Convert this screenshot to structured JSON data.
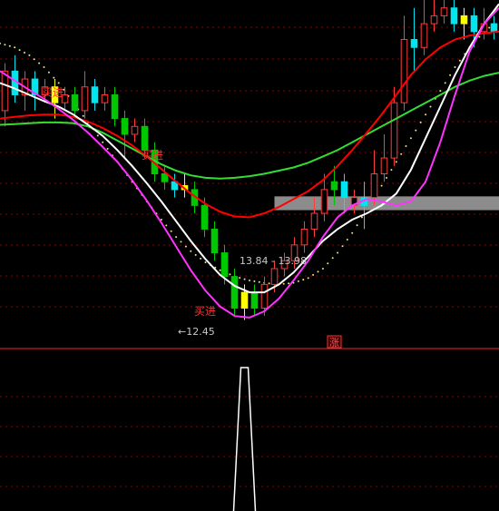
{
  "chart_data": {
    "type": "candlestick",
    "colors": {
      "background": "#000000",
      "grid": "#8b0000",
      "up": "#ff3b3b",
      "down_green": "#00c800",
      "down_cyan": "#00e5ee",
      "doji_yellow": "#ffff00",
      "ma_white": "#ffffff",
      "ma_magenta": "#ff33ff",
      "ma_red": "#ff0000",
      "ma_green": "#33dd33",
      "dotted": "#e6e68c",
      "band": "#8c8c8c",
      "spike": "#ffffff"
    },
    "price_axis": {
      "ylim": [
        12.1,
        16.5
      ]
    },
    "candles": [
      [
        15.1,
        15.6,
        15.7,
        14.9,
        "up"
      ],
      [
        15.6,
        15.3,
        15.8,
        15.2,
        "down_cyan"
      ],
      [
        15.3,
        15.5,
        15.6,
        15.1,
        "up"
      ],
      [
        15.5,
        15.3,
        15.6,
        15.1,
        "down_cyan"
      ],
      [
        15.3,
        15.4,
        15.5,
        15.2,
        "up"
      ],
      [
        15.4,
        15.2,
        15.5,
        15.0,
        "doji_yellow"
      ],
      [
        15.2,
        15.3,
        15.4,
        15.1,
        "up"
      ],
      [
        15.3,
        15.1,
        15.4,
        15.0,
        "down_green"
      ],
      [
        15.1,
        15.4,
        15.6,
        15.0,
        "up"
      ],
      [
        15.4,
        15.2,
        15.5,
        15.1,
        "down_cyan"
      ],
      [
        15.2,
        15.3,
        15.4,
        15.1,
        "up"
      ],
      [
        15.3,
        15.0,
        15.4,
        14.9,
        "down_green"
      ],
      [
        15.0,
        14.8,
        15.1,
        14.5,
        "down_green"
      ],
      [
        14.8,
        14.9,
        15.0,
        14.7,
        "up"
      ],
      [
        14.9,
        14.6,
        15.0,
        14.5,
        "down_green"
      ],
      [
        14.6,
        14.3,
        14.7,
        14.2,
        "down_green"
      ],
      [
        14.3,
        14.2,
        14.4,
        14.1,
        "down_green"
      ],
      [
        14.2,
        14.1,
        14.3,
        14.0,
        "down_cyan"
      ],
      [
        14.1,
        14.15,
        14.3,
        14.0,
        "doji_yellow"
      ],
      [
        14.1,
        13.9,
        14.2,
        13.8,
        "down_green"
      ],
      [
        13.9,
        13.6,
        14.0,
        13.5,
        "down_green"
      ],
      [
        13.6,
        13.3,
        13.7,
        13.2,
        "down_green"
      ],
      [
        13.3,
        13.0,
        13.4,
        12.9,
        "down_green"
      ],
      [
        13.0,
        12.6,
        13.1,
        12.5,
        "down_green"
      ],
      [
        12.6,
        12.8,
        12.9,
        12.45,
        "doji_yellow"
      ],
      [
        12.8,
        12.6,
        12.9,
        12.5,
        "down_green"
      ],
      [
        12.6,
        12.9,
        13.0,
        12.5,
        "up"
      ],
      [
        12.9,
        13.1,
        13.2,
        12.8,
        "up"
      ],
      [
        13.1,
        13.2,
        13.3,
        13.0,
        "up"
      ],
      [
        13.2,
        13.4,
        13.5,
        13.1,
        "up"
      ],
      [
        13.4,
        13.6,
        13.7,
        13.3,
        "up"
      ],
      [
        13.6,
        13.8,
        14.0,
        13.5,
        "up"
      ],
      [
        13.8,
        14.1,
        14.3,
        13.7,
        "up"
      ],
      [
        14.1,
        14.2,
        14.4,
        13.9,
        "down_green"
      ],
      [
        14.2,
        14.0,
        14.3,
        13.8,
        "down_cyan"
      ],
      [
        14.0,
        13.9,
        14.1,
        13.8,
        "up"
      ],
      [
        13.9,
        14.0,
        14.2,
        13.6,
        "down_cyan"
      ],
      [
        14.0,
        14.3,
        14.6,
        13.9,
        "up"
      ],
      [
        14.3,
        14.5,
        14.8,
        14.2,
        "up"
      ],
      [
        14.5,
        15.2,
        15.4,
        14.4,
        "up"
      ],
      [
        15.2,
        16.0,
        16.3,
        15.1,
        "up"
      ],
      [
        16.0,
        15.9,
        16.4,
        15.6,
        "down_cyan"
      ],
      [
        15.9,
        16.2,
        16.5,
        15.8,
        "up"
      ],
      [
        16.2,
        16.3,
        16.5,
        16.1,
        "up"
      ],
      [
        16.3,
        16.4,
        16.5,
        16.2,
        "up"
      ],
      [
        16.4,
        16.2,
        16.5,
        16.1,
        "down_cyan"
      ],
      [
        16.2,
        16.3,
        16.4,
        16.0,
        "doji_yellow"
      ],
      [
        16.3,
        16.1,
        16.4,
        15.9,
        "down_cyan"
      ],
      [
        16.1,
        16.2,
        16.4,
        16.0,
        "up"
      ],
      [
        16.2,
        16.1,
        16.3,
        16.0,
        "down_cyan"
      ]
    ],
    "ma_white": [
      15.45,
      15.38,
      15.3,
      15.22,
      15.15,
      15.05,
      14.92,
      14.78,
      14.6,
      14.4,
      14.18,
      13.95,
      13.7,
      13.45,
      13.22,
      13.02,
      12.88,
      12.8,
      12.8,
      12.9,
      13.05,
      13.25,
      13.45,
      13.6,
      13.72,
      13.8,
      13.9,
      14.05,
      14.35,
      14.75,
      15.15,
      15.55,
      15.9,
      16.2,
      16.45
    ],
    "ma_magenta": [
      15.6,
      15.48,
      15.36,
      15.25,
      15.12,
      14.98,
      14.82,
      14.64,
      14.45,
      14.22,
      13.96,
      13.68,
      13.38,
      13.08,
      12.82,
      12.62,
      12.5,
      12.48,
      12.56,
      12.72,
      12.95,
      13.2,
      13.5,
      13.75,
      13.9,
      13.98,
      13.95,
      13.9,
      13.95,
      14.2,
      14.7,
      15.3,
      15.85,
      16.2,
      16.4
    ],
    "ma_red": [
      15.0,
      15.02,
      15.04,
      15.05,
      15.05,
      15.02,
      14.96,
      14.88,
      14.78,
      14.66,
      14.52,
      14.36,
      14.2,
      14.05,
      13.92,
      13.82,
      13.76,
      13.75,
      13.8,
      13.88,
      13.98,
      14.08,
      14.22,
      14.4,
      14.6,
      14.82,
      15.05,
      15.3,
      15.55,
      15.75,
      15.9,
      16.0,
      16.05,
      16.08,
      16.1
    ],
    "ma_green": [
      14.92,
      14.93,
      14.94,
      14.95,
      14.95,
      14.94,
      14.9,
      14.82,
      14.72,
      14.62,
      14.52,
      14.42,
      14.34,
      14.28,
      14.25,
      14.24,
      14.25,
      14.27,
      14.3,
      14.34,
      14.38,
      14.44,
      14.52,
      14.6,
      14.7,
      14.8,
      14.9,
      15.0,
      15.1,
      15.2,
      15.3,
      15.4,
      15.48,
      15.54,
      15.58
    ],
    "dotted": [
      15.95,
      15.9,
      15.8,
      15.65,
      15.45,
      15.2,
      14.95,
      14.7,
      14.45,
      14.2,
      13.95,
      13.72,
      13.5,
      13.32,
      13.18,
      13.08,
      13.0,
      12.95,
      12.92,
      12.9,
      12.92,
      12.98,
      13.1,
      13.3,
      13.55,
      13.85,
      14.15,
      14.45,
      14.75,
      15.05,
      15.35,
      15.65,
      15.9,
      16.1,
      16.25
    ],
    "band_price_range": [
      13.84,
      13.98
    ],
    "annotations": [
      {
        "text": "买进",
        "price": 15.1,
        "index": 5
      },
      {
        "text": "买进",
        "price": 14.0,
        "index": 18
      },
      {
        "text": "买进",
        "price": 12.55,
        "index": 25
      },
      {
        "text": "13.84 - 13.98",
        "price": 13.91,
        "index": 31
      },
      {
        "text": "←12.45",
        "price": 12.45,
        "index": 24
      },
      {
        "text": "涨",
        "price": null,
        "index": null
      }
    ],
    "indicator": {
      "ylim": [
        0,
        1
      ],
      "values": [
        0,
        0,
        0,
        0,
        0,
        0,
        0,
        0,
        0,
        0,
        0,
        0,
        0,
        0,
        0,
        0,
        0,
        0,
        0,
        0,
        0,
        0,
        0,
        0,
        1,
        0,
        0,
        0,
        0,
        0,
        0,
        0,
        0,
        0,
        0,
        0,
        0,
        0,
        0,
        0,
        0,
        0,
        0,
        0,
        0,
        0,
        0,
        0,
        0,
        0
      ]
    }
  }
}
